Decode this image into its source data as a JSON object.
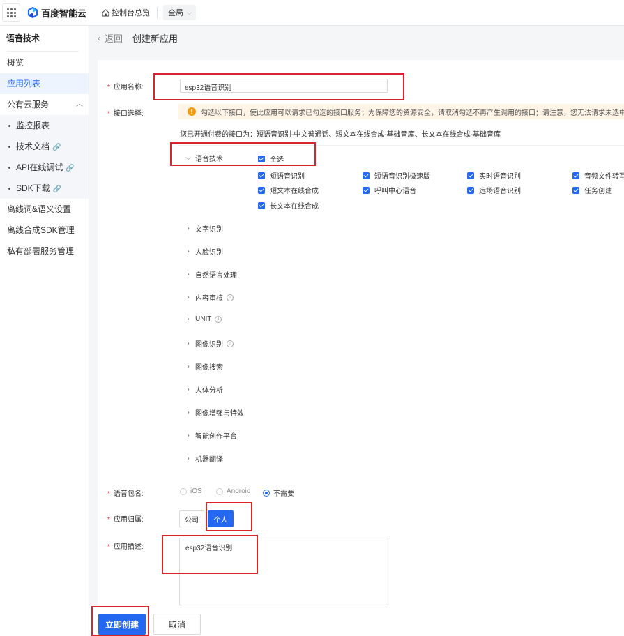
{
  "topbar": {
    "brand": "百度智能云",
    "console_label": "控制台总览",
    "region_label": "全局"
  },
  "sidebar": {
    "title": "语音技术",
    "items": [
      {
        "label": "概览"
      },
      {
        "label": "应用列表"
      },
      {
        "label": "公有云服务"
      },
      {
        "label": "监控报表"
      },
      {
        "label": "技术文档"
      },
      {
        "label": "API在线调试"
      },
      {
        "label": "SDK下载"
      },
      {
        "label": "离线词&语义设置"
      },
      {
        "label": "离线合成SDK管理"
      },
      {
        "label": "私有部署服务管理"
      }
    ]
  },
  "breadcrumb": {
    "back": "返回",
    "title": "创建新应用"
  },
  "form": {
    "app_name_label": "应用名称:",
    "app_name_value": "esp32语音识别",
    "api_label": "接口选择:",
    "notice": "勾选以下接口，使此应用可以请求已勾选的接口服务；为保障您的资源安全，请取消勾选不再产生调用的接口；请注意，您无法请求未选中状态的接口服务",
    "opened_text": "您已开通付费的接口为：短语音识别-中文普通话、短文本在线合成-基础音库、长文本在线合成-基础音库",
    "speech_group": "语音技术",
    "select_all": "全选",
    "speech_options": [
      "短语音识别",
      "短语音识别极速版",
      "实时语音识别",
      "音频文件转写",
      "短文本在线合成",
      "呼叫中心语音",
      "远场语音识别",
      "任务创建",
      "长文本在线合成"
    ],
    "other_groups": [
      "文字识别",
      "人脸识别",
      "自然语言处理",
      "内容审核",
      "UNIT",
      "图像识别",
      "图像搜索",
      "人体分析",
      "图像增强与特效",
      "智能创作平台",
      "机器翻译"
    ],
    "package_label": "语音包名:",
    "package_options": [
      "iOS",
      "Android",
      "不需要"
    ],
    "package_selected": "不需要",
    "owner_label": "应用归属:",
    "owner_options": [
      "公司",
      "个人"
    ],
    "owner_selected": "个人",
    "desc_label": "应用描述:",
    "desc_value": "esp32语音识别"
  },
  "actions": {
    "create": "立即创建",
    "cancel": "取消"
  }
}
